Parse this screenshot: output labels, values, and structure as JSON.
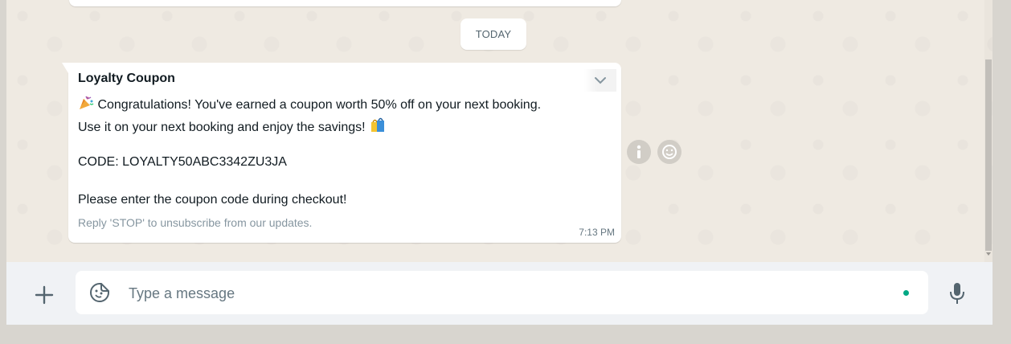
{
  "date_divider": "TODAY",
  "message": {
    "title": "Loyalty Coupon",
    "line1": "Congratulations! You've earned a coupon worth 50% off on your next booking.",
    "line2": "Use it on your next booking and enjoy the savings!",
    "code": "CODE: LOYALTY50ABC3342ZU3JA",
    "instruction": "Please enter the coupon code during checkout!",
    "footer": "Reply 'STOP' to unsubscribe from our updates.",
    "time": "7:13 PM"
  },
  "composer": {
    "placeholder": "Type a message"
  },
  "icons": {
    "plus": "plus-icon",
    "sticker": "sticker-icon",
    "mic": "microphone-icon",
    "info": "info-icon",
    "emoji": "emoji-reaction-icon",
    "chevron": "chevron-down-icon",
    "party": "party-popper-emoji",
    "bags": "shopping-bags-emoji"
  },
  "colors": {
    "chat_background": "#efeae2",
    "bubble": "#ffffff",
    "accent": "#00a884",
    "text": "#111b21",
    "muted": "#8696a0"
  }
}
